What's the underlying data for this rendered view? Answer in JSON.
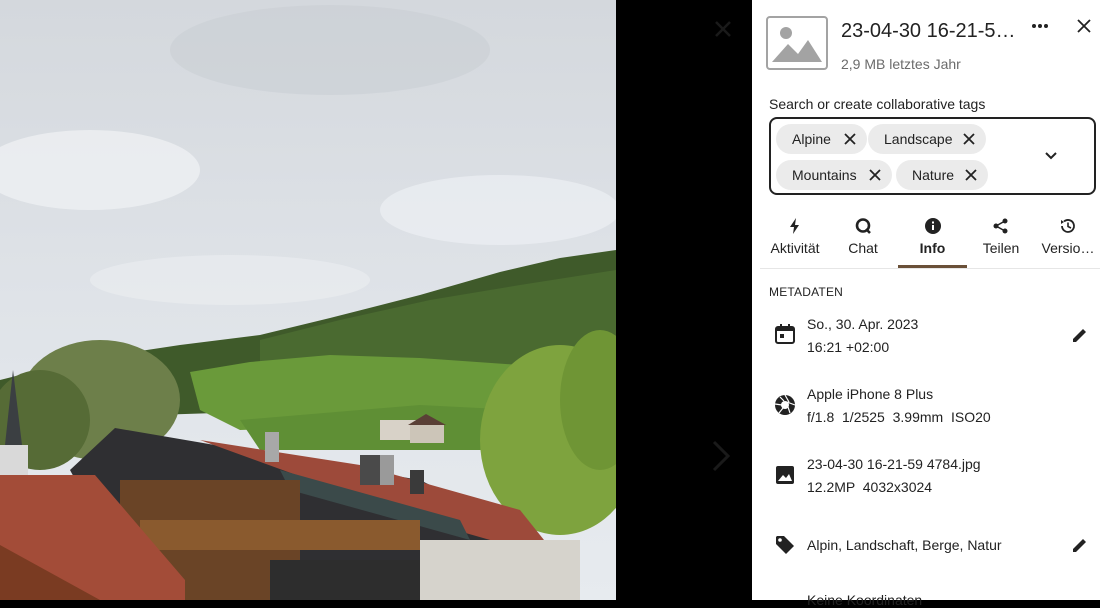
{
  "viewer": {
    "close_icon": "close-icon",
    "next_icon": "chevron-right-icon"
  },
  "header": {
    "title": "23-04-30 16-21-5…",
    "subtitle": "2,9 MB letztes Jahr",
    "more_icon": "dots-horizontal-icon",
    "close_icon": "close-icon"
  },
  "tags": {
    "label": "Search or create collaborative tags",
    "chips": [
      "Alpine",
      "Landscape",
      "Mountains",
      "Nature"
    ],
    "dropdown_icon": "chevron-down-icon"
  },
  "tabs": [
    {
      "label": "Aktivität",
      "icon": "lightning-icon",
      "active": false
    },
    {
      "label": "Chat",
      "icon": "chat-icon",
      "active": false
    },
    {
      "label": "Info",
      "icon": "info-icon",
      "active": true
    },
    {
      "label": "Teilen",
      "icon": "share-icon",
      "active": false
    },
    {
      "label": "Versio…",
      "icon": "history-icon",
      "active": false
    }
  ],
  "metadata": {
    "section_title": "METADATEN",
    "date": {
      "line1": "So., 30. Apr. 2023",
      "line2": "16:21 +02:00"
    },
    "camera": {
      "line1": "Apple iPhone 8 Plus",
      "line2": "f/1.8  1/2525  3.99mm  ISO20"
    },
    "image": {
      "line1": "23-04-30 16-21-59 4784.jpg",
      "line2": "12.2MP  4032x3024"
    },
    "tags": {
      "line1": "Alpin, Landschaft, Berge, Natur"
    },
    "location": {
      "line1": "Keine Koordinaten"
    }
  },
  "colors": {
    "accent": "#6a5038",
    "chip_bg": "#ebebeb",
    "text": "#222222",
    "muted": "#6b6b6b"
  }
}
